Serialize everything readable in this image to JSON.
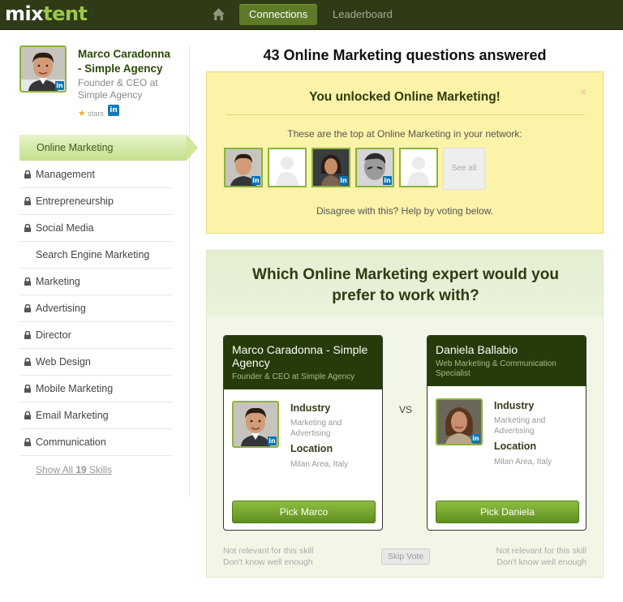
{
  "header": {
    "logo_mix": "mix",
    "logo_tent": "tent",
    "nav_connections": "Connections",
    "nav_leaderboard": "Leaderboard"
  },
  "profile": {
    "name": "Marco Caradonna - Simple Agency",
    "title": "Founder & CEO at Simple Agency",
    "stars_label": "stars",
    "linkedin_badge": "in"
  },
  "skills": {
    "active": "Online Marketing",
    "items": [
      {
        "label": "Management",
        "locked": true
      },
      {
        "label": "Entrepreneurship",
        "locked": true
      },
      {
        "label": "Social Media",
        "locked": true
      },
      {
        "label": "Search Engine Marketing",
        "locked": false
      },
      {
        "label": "Marketing",
        "locked": true
      },
      {
        "label": "Advertising",
        "locked": true
      },
      {
        "label": "Director",
        "locked": true
      },
      {
        "label": "Web Design",
        "locked": true
      },
      {
        "label": "Mobile Marketing",
        "locked": true
      },
      {
        "label": "Email Marketing",
        "locked": true
      },
      {
        "label": "Communication",
        "locked": true
      }
    ],
    "show_all_prefix": "Show All ",
    "show_all_count": "19",
    "show_all_suffix": " Skills"
  },
  "main": {
    "title": "43 Online Marketing questions answered"
  },
  "unlock": {
    "title": "You unlocked Online Marketing!",
    "close": "×",
    "subtitle": "These are the top at Online Marketing in your network:",
    "see_all": "See all",
    "footer": "Disagree with this? Help by voting below."
  },
  "vote": {
    "title": "Which Online Marketing expert would you prefer to work with?",
    "vs": "VS",
    "left": {
      "name": "Marco Caradonna - Simple Agency",
      "role": "Founder & CEO at Simple Agency",
      "industry_label": "Industry",
      "industry": "Marketing and Advertising",
      "location_label": "Location",
      "location": "Milan Area, Italy",
      "pick": "Pick Marco"
    },
    "right": {
      "name": "Daniela Ballabio",
      "role": "Web Marketing & Communication Specialist",
      "industry_label": "Industry",
      "industry": "Marketing and Advertising",
      "location_label": "Location",
      "location": "Milan Area, Italy",
      "pick": "Pick Daniela"
    },
    "not_relevant": "Not relevant for this skill",
    "dont_know": "Don't know well enough",
    "skip": "Skip Vote"
  }
}
